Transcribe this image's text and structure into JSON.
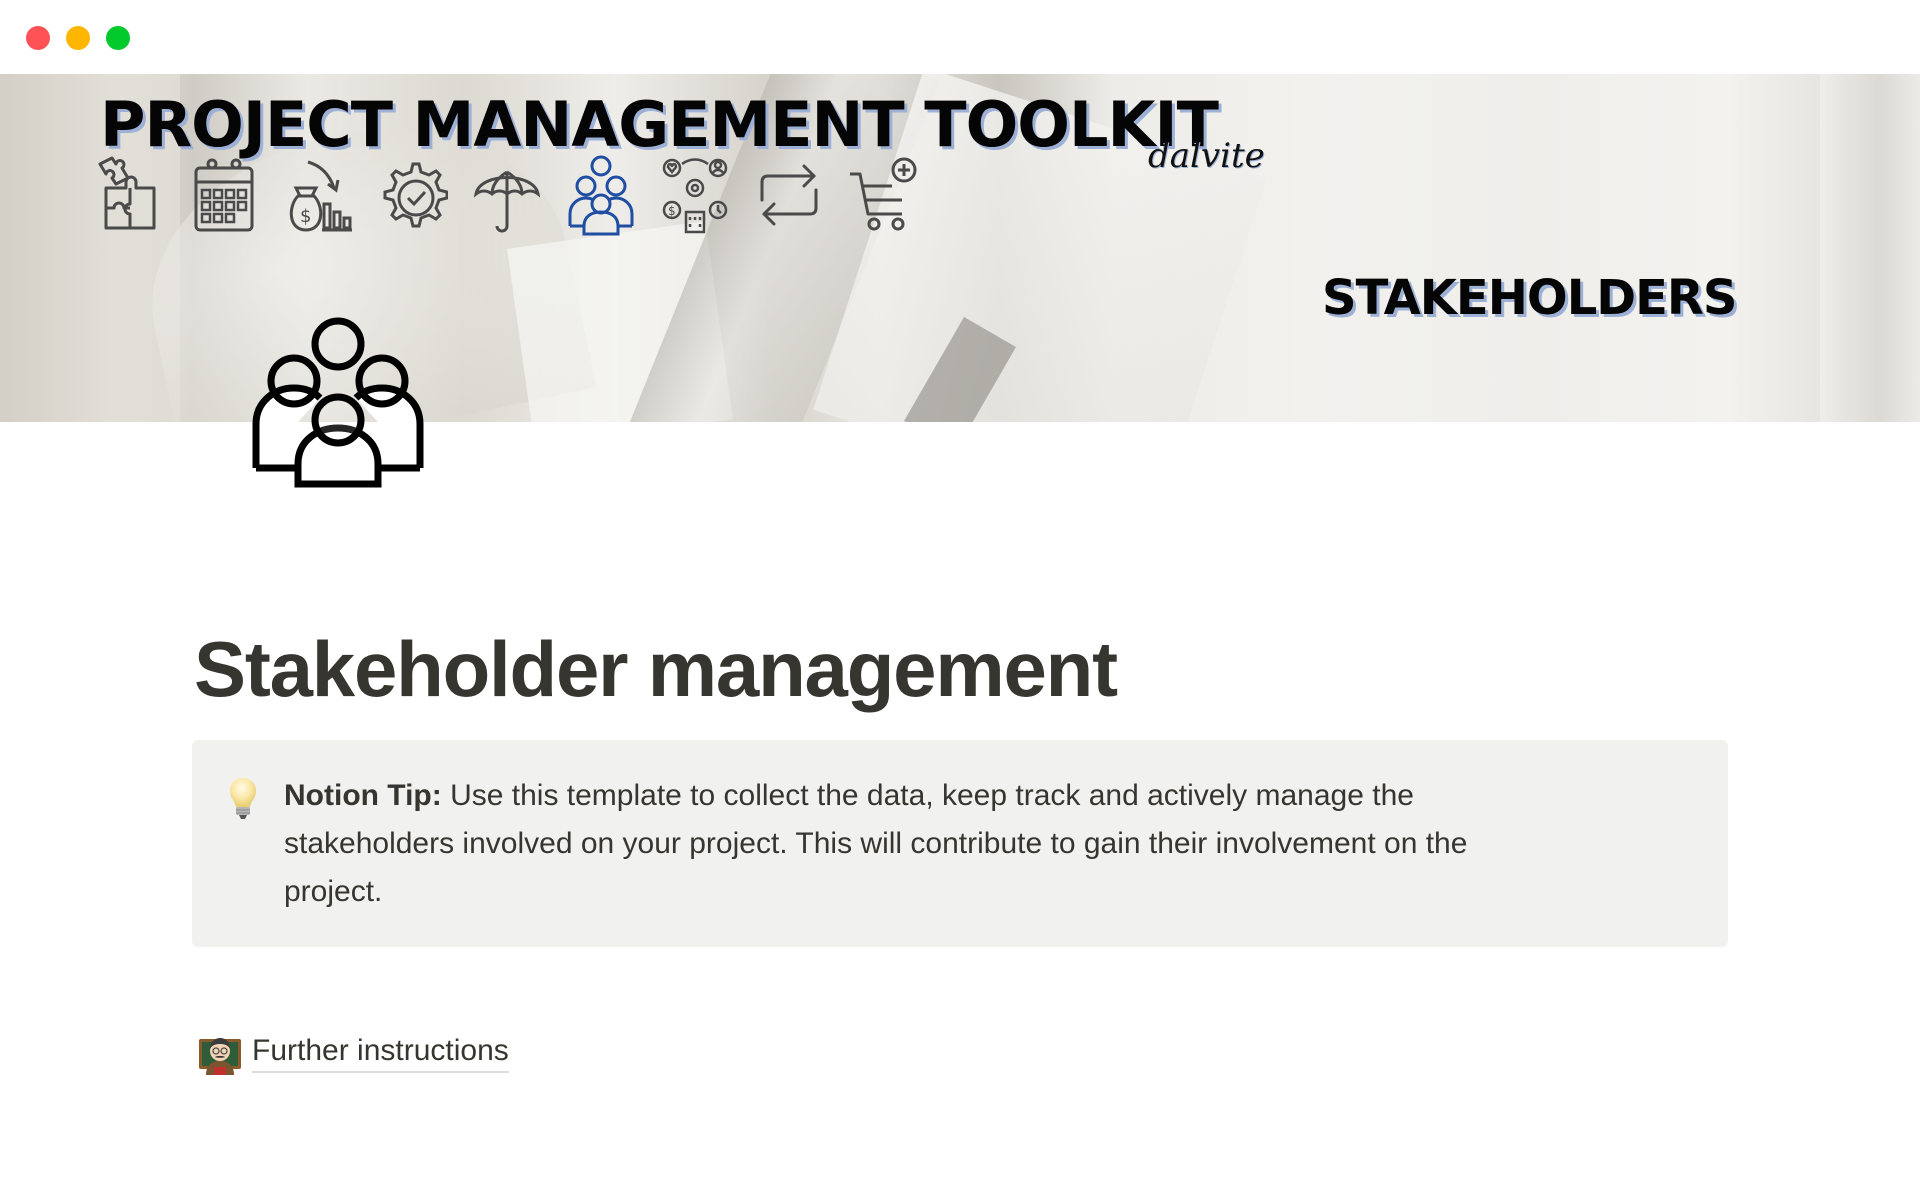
{
  "window": {
    "controls": [
      "close",
      "minimize",
      "maximize"
    ],
    "colors": {
      "close": "#ff5257",
      "minimize": "#ffb602",
      "maximize": "#00c92c"
    }
  },
  "cover": {
    "title": "PROJECT MANAGEMENT TOOLKIT",
    "signature": "dalvite",
    "section": "STAKEHOLDERS",
    "accent_color": "#1f4ea3",
    "nav_icons": [
      {
        "name": "scope-puzzle-icon",
        "active": false
      },
      {
        "name": "schedule-calendar-icon",
        "active": false
      },
      {
        "name": "cost-money-bag-icon",
        "active": false
      },
      {
        "name": "quality-gear-check-icon",
        "active": false
      },
      {
        "name": "risk-umbrella-icon",
        "active": false
      },
      {
        "name": "stakeholders-group-icon",
        "active": true
      },
      {
        "name": "resources-network-icon",
        "active": false
      },
      {
        "name": "change-arrows-icon",
        "active": false
      },
      {
        "name": "procurement-cart-icon",
        "active": false
      }
    ]
  },
  "page": {
    "icon": "stakeholders-group-icon",
    "title": "Stakeholder management"
  },
  "callout": {
    "icon": "light-bulb-icon",
    "bold": "Notion Tip:",
    "lines": [
      " Use this template to collect the data, keep track and actively manage the",
      "stakeholders involved on your project. This will contribute to gain their involvement on the",
      "project."
    ],
    "background": "#f1f1ef"
  },
  "link": {
    "icon": "teacher-emoji-icon",
    "label": "Further instructions"
  }
}
